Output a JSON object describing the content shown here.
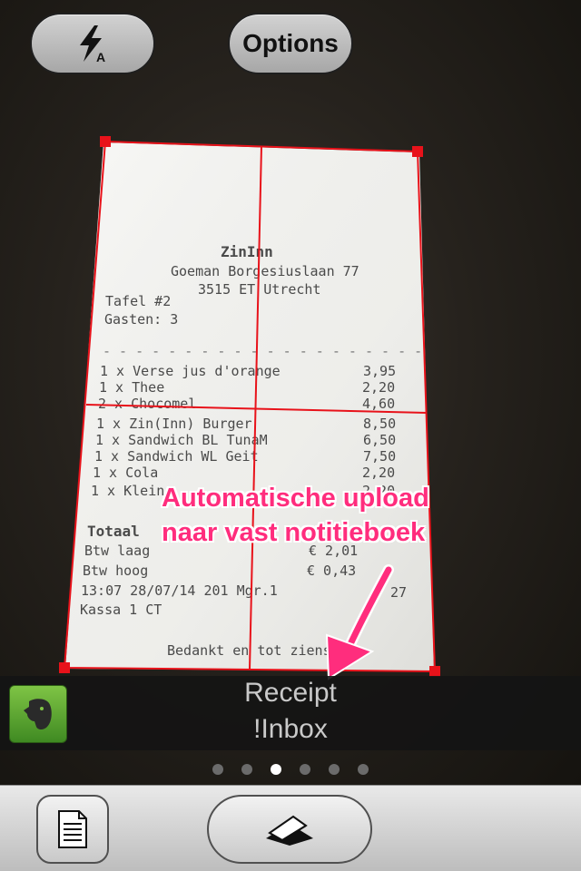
{
  "top_bar": {
    "flash_icon": "flash-auto-icon",
    "options_label": "Options"
  },
  "receipt": {
    "name": "ZinInn",
    "address_line1": "Goeman Borgesiuslaan 77",
    "address_line2": "3515 ET Utrecht",
    "table": "Tafel #2",
    "guests": "Gasten: 3",
    "items": [
      {
        "desc": "1 x Verse jus d'orange",
        "price": "3,95"
      },
      {
        "desc": "1 x Thee",
        "price": "2,20"
      },
      {
        "desc": "2 x Chocomel",
        "price": "4,60"
      },
      {
        "desc": "1 x Zin(Inn) Burger",
        "price": "8,50"
      },
      {
        "desc": "1 x Sandwich BL TunaM",
        "price": "6,50"
      },
      {
        "desc": "1 x Sandwich WL Geit",
        "price": "7,50"
      },
      {
        "desc": "1 x Cola",
        "price": "2,20"
      },
      {
        "desc": "1 x Klein",
        "price": "2,20"
      }
    ],
    "total_label": "Totaal",
    "vat_low_label": "Btw laag",
    "vat_low_value": "€ 2,01",
    "vat_high_label": "Btw hoog",
    "vat_high_value": "€ 0,43",
    "timestamp_line": "13:07 28/07/14 201 Mgr.1",
    "timestamp_code": "27",
    "register": "Kassa 1 CT",
    "footer": "Bedankt en tot ziens"
  },
  "annotation": {
    "line1": "Automatische upload",
    "line2": "naar vast notitieboek",
    "color": "#ff2d7d"
  },
  "destination": {
    "app_icon": "evernote-elephant-icon",
    "title": "Receipt",
    "notebook": "!Inbox"
  },
  "pager": {
    "count": 6,
    "active_index": 2
  },
  "bottom_toolbar": {
    "left_icon": "document-icon",
    "center_icon": "scanner-icon"
  }
}
